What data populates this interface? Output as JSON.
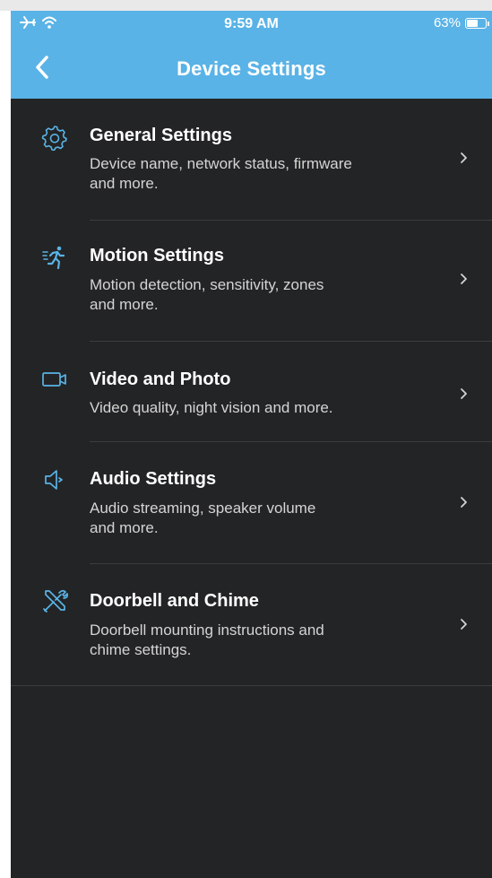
{
  "status_bar": {
    "time": "9:59 AM",
    "battery_percent_label": "63%",
    "battery_level": 0.63,
    "icons": [
      "airplane-icon",
      "wifi-icon",
      "battery-icon"
    ]
  },
  "header": {
    "title": "Device Settings",
    "back_icon": "chevron-left-icon",
    "background_color": "#5ab3e6"
  },
  "colors": {
    "screen_background": "#232425",
    "accent": "#5ab3e6",
    "divider": "#3b3c3e",
    "title_text": "#ffffff",
    "description_text": "#d4d4d4"
  },
  "settings": {
    "items": [
      {
        "title": "General Settings",
        "description_line1": "Device name, network status, firmware",
        "description_line2": "and more.",
        "icon": "gear-icon"
      },
      {
        "title": "Motion Settings",
        "description_line1": "Motion detection, sensitivity, zones",
        "description_line2": "and more.",
        "icon": "running-person-icon"
      },
      {
        "title": "Video and Photo",
        "description_line1": "Video quality, night vision and more.",
        "description_line2": "",
        "icon": "video-camera-icon"
      },
      {
        "title": "Audio Settings",
        "description_line1": "Audio streaming, speaker volume",
        "description_line2": "and more.",
        "icon": "speaker-icon"
      },
      {
        "title": "Doorbell and Chime",
        "description_line1": "Doorbell mounting instructions and",
        "description_line2": "chime settings.",
        "icon": "tools-icon"
      }
    ]
  }
}
